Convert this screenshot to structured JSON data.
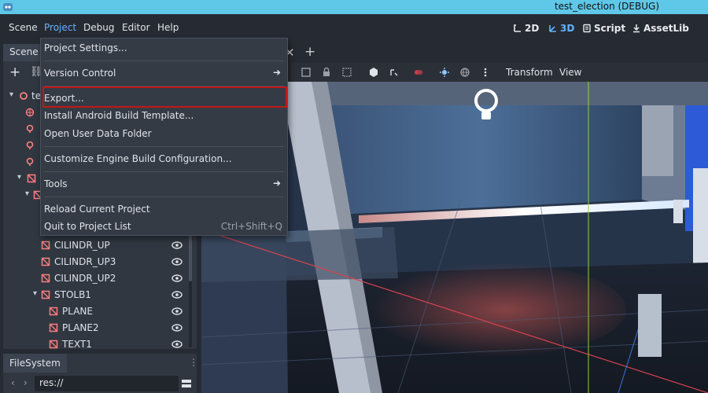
{
  "window": {
    "title": "test_election (DEBUG)"
  },
  "menubar": {
    "items": [
      "Scene",
      "Project",
      "Debug",
      "Editor",
      "Help"
    ],
    "active": "Project",
    "workspaces": [
      "2D",
      "3D",
      "Script",
      "AssetLib"
    ]
  },
  "project_menu": {
    "items": [
      {
        "label": "Project Settings..."
      },
      {
        "label": "Version Control",
        "submenu": true
      },
      {
        "label": "Export...",
        "highlighted": true
      },
      {
        "label": "Install Android Build Template..."
      },
      {
        "label": "Open User Data Folder"
      },
      {
        "label": "Customize Engine Build Configuration..."
      },
      {
        "label": "Tools",
        "submenu": true
      },
      {
        "label": "Reload Current Project"
      },
      {
        "label": "Quit to Project List",
        "shortcut": "Ctrl+Shift+Q"
      }
    ]
  },
  "scene_dock": {
    "tab": "Scene",
    "root_partial": "te",
    "nodes": [
      "CILINDR_UP",
      "CILINDR_UP3",
      "CILINDR_UP2",
      "STOLB1",
      "PLANE",
      "PLANE2",
      "TEXT1"
    ]
  },
  "viewport_toolbar": {
    "transform": "Transform",
    "view": "View"
  },
  "filesystem": {
    "tab": "FileSystem",
    "path": "res://"
  },
  "colors": {
    "accent": "#66b3ff",
    "highlight_border": "#c11717",
    "titlebar": "#5fc7e8",
    "node_red": "#fc7f7f"
  }
}
